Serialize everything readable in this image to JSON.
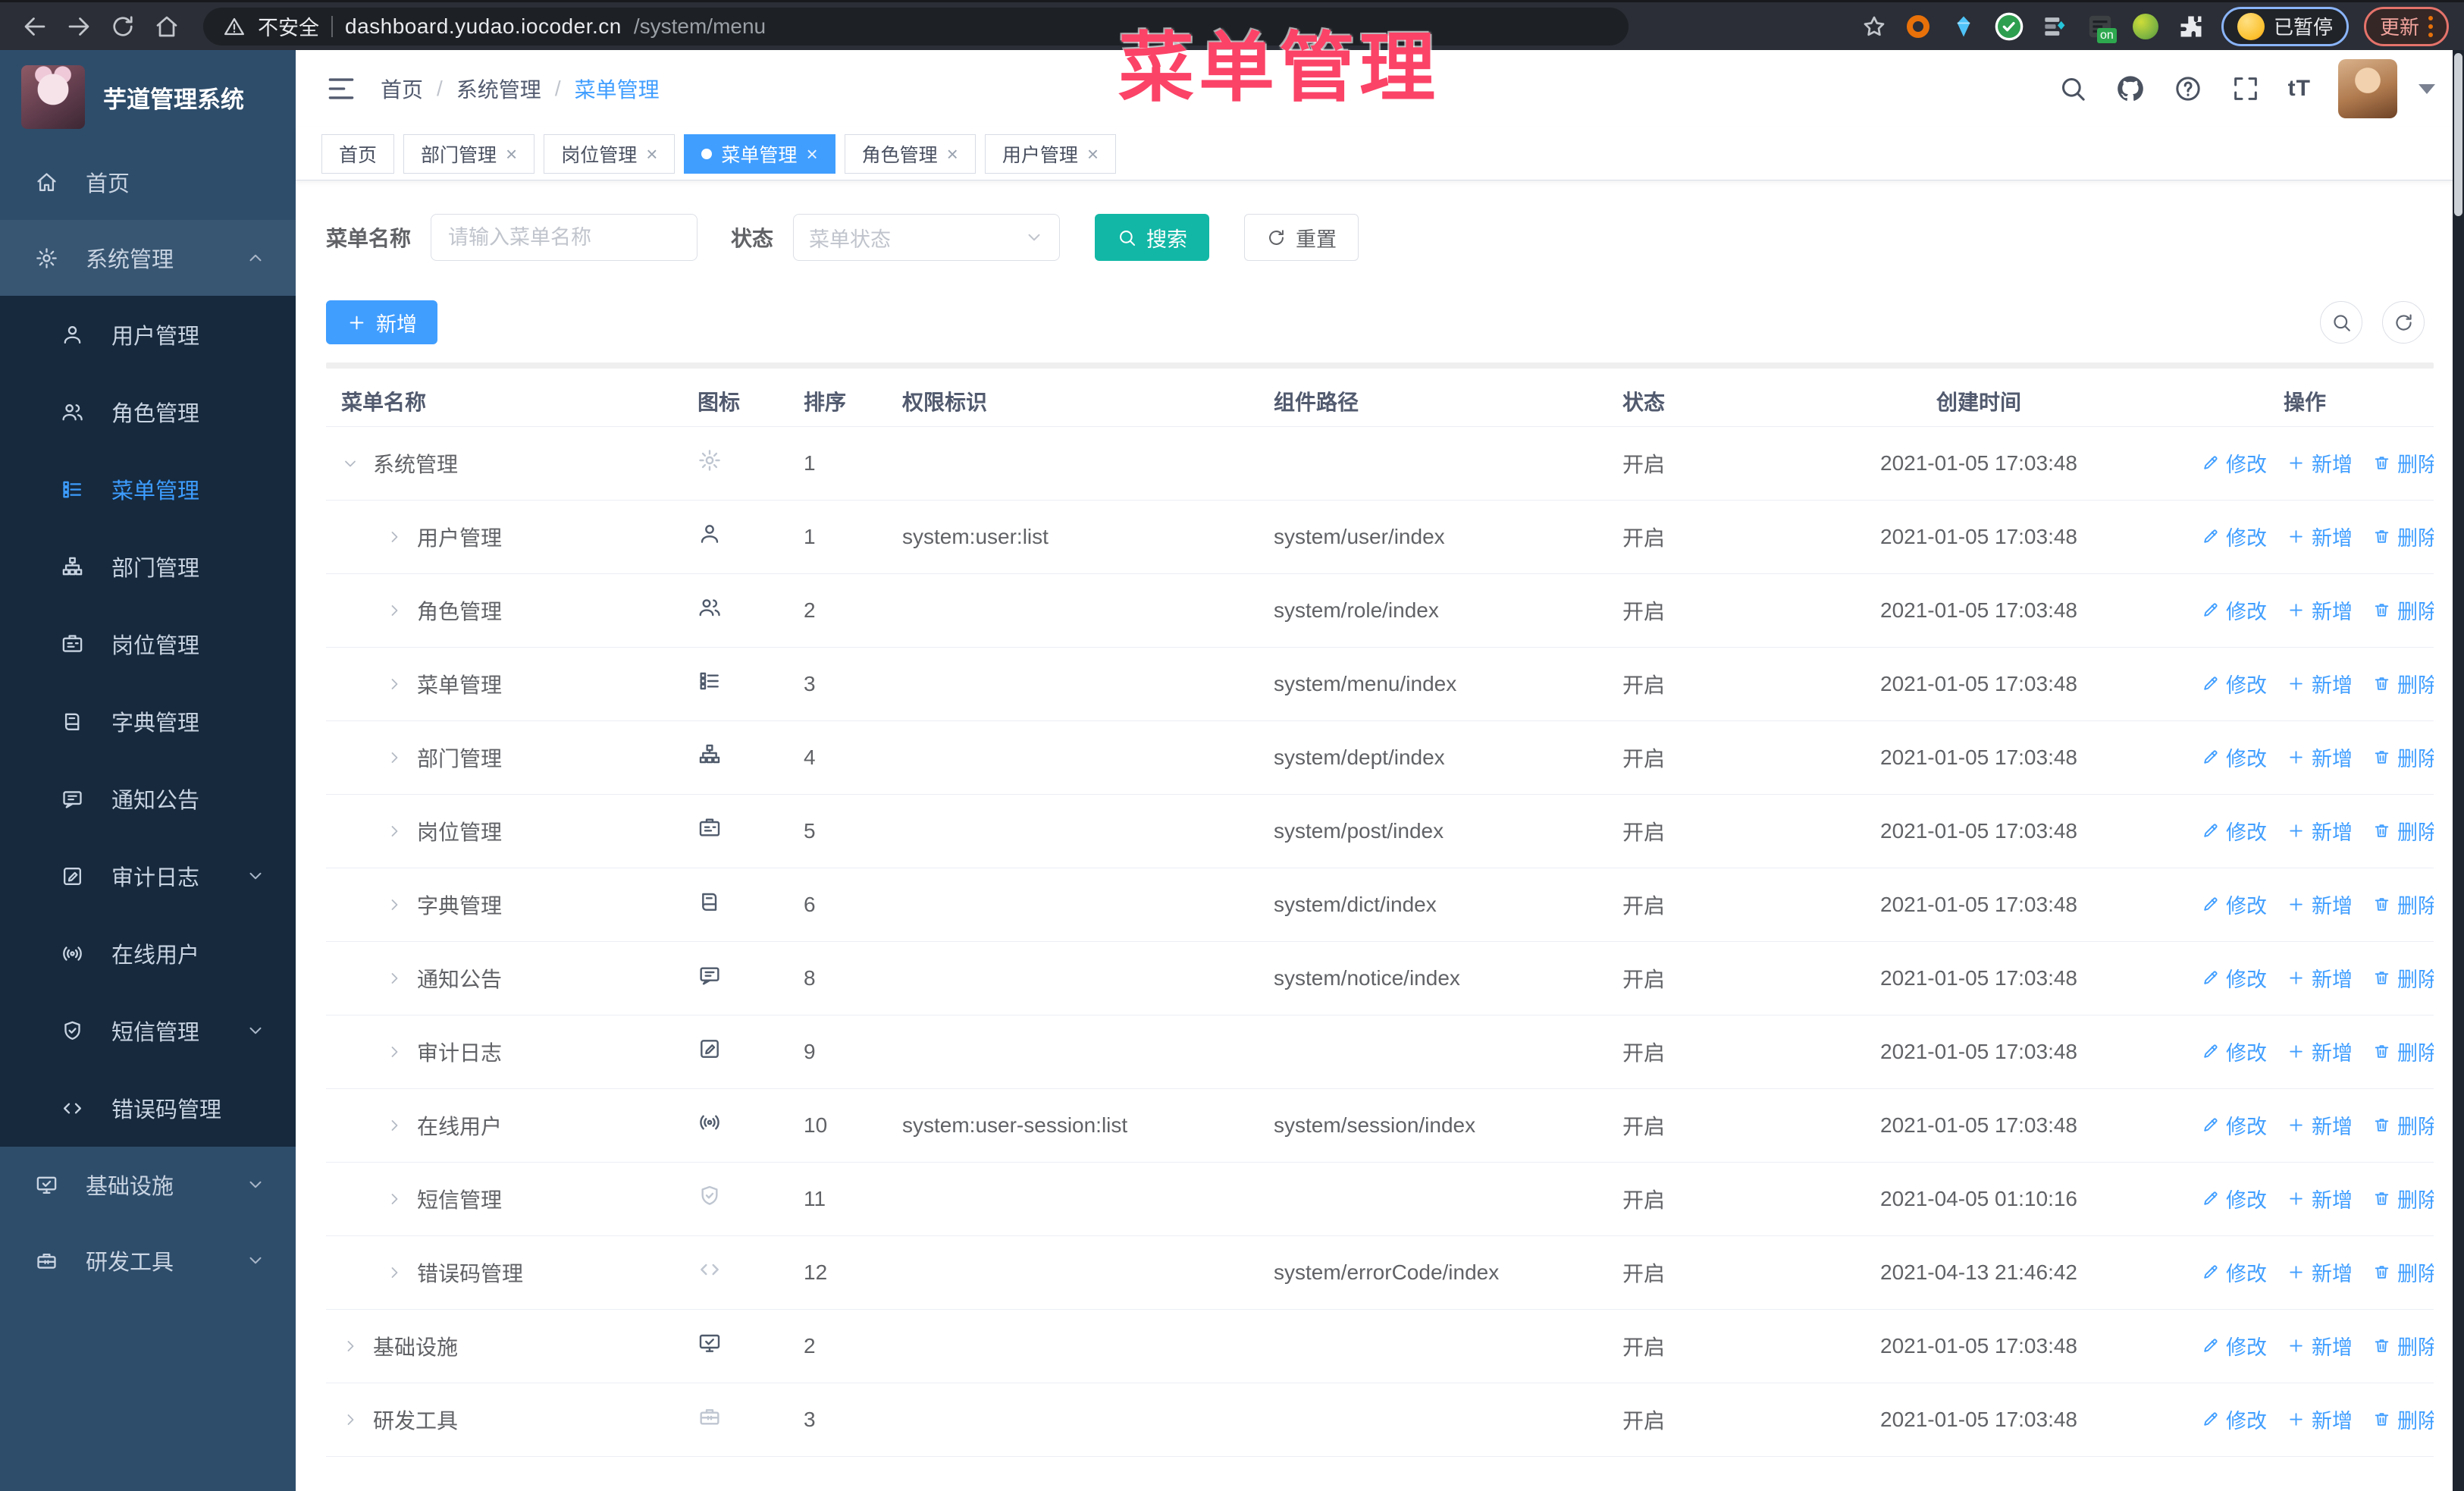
{
  "browser": {
    "insecure_label": "不安全",
    "url_host": "dashboard.yudao.iocoder.cn",
    "url_path": "/system/menu",
    "ext_on_label": "on",
    "paused_label": "已暂停",
    "update_label": "更新"
  },
  "annotation": {
    "title": "菜单管理",
    "color": "#fb4367"
  },
  "sidebar": {
    "app_title": "芋道管理系统",
    "items": [
      {
        "label": "首页",
        "icon": "home-icon",
        "level": 0
      },
      {
        "label": "系统管理",
        "icon": "gear-icon",
        "level": 0,
        "chevron": "up",
        "open": true
      },
      {
        "label": "用户管理",
        "icon": "user-icon",
        "level": 1
      },
      {
        "label": "角色管理",
        "icon": "users-icon",
        "level": 1
      },
      {
        "label": "菜单管理",
        "icon": "menu-icon",
        "level": 1,
        "active": true
      },
      {
        "label": "部门管理",
        "icon": "org-tree-icon",
        "level": 1
      },
      {
        "label": "岗位管理",
        "icon": "badge-icon",
        "level": 1
      },
      {
        "label": "字典管理",
        "icon": "dict-icon",
        "level": 1
      },
      {
        "label": "通知公告",
        "icon": "message-icon",
        "level": 1
      },
      {
        "label": "审计日志",
        "icon": "log-icon",
        "level": 1,
        "chevron": "down"
      },
      {
        "label": "在线用户",
        "icon": "online-icon",
        "level": 1
      },
      {
        "label": "短信管理",
        "icon": "shield-icon",
        "level": 1,
        "chevron": "down"
      },
      {
        "label": "错误码管理",
        "icon": "code-icon",
        "level": 1
      },
      {
        "label": "基础设施",
        "icon": "monitor-icon",
        "level": 0,
        "chevron": "down"
      },
      {
        "label": "研发工具",
        "icon": "toolbox-icon",
        "level": 0,
        "chevron": "down"
      }
    ]
  },
  "breadcrumb": {
    "items": [
      "首页",
      "系统管理",
      "菜单管理"
    ],
    "separator": "/"
  },
  "header": {
    "font_size_glyph": "tT",
    "tool_icons": [
      "search-icon",
      "github-icon",
      "question-icon",
      "fullscreen-icon",
      "font-size-icon"
    ]
  },
  "tabs": [
    {
      "label": "首页",
      "closable": false,
      "active": false
    },
    {
      "label": "部门管理",
      "closable": true,
      "active": false
    },
    {
      "label": "岗位管理",
      "closable": true,
      "active": false
    },
    {
      "label": "菜单管理",
      "closable": true,
      "active": true
    },
    {
      "label": "角色管理",
      "closable": true,
      "active": false
    },
    {
      "label": "用户管理",
      "closable": true,
      "active": false
    }
  ],
  "search": {
    "name_label": "菜单名称",
    "name_placeholder": "请输入菜单名称",
    "name_value": "",
    "status_label": "状态",
    "status_placeholder": "菜单状态",
    "search_button": "搜索",
    "reset_button": "重置"
  },
  "toolbar": {
    "add_button": "新增"
  },
  "table": {
    "columns": [
      "菜单名称",
      "图标",
      "排序",
      "权限标识",
      "组件路径",
      "状态",
      "创建时间",
      "操作"
    ],
    "row_actions": [
      "修改",
      "新增",
      "删除"
    ],
    "rows": [
      {
        "name": "系统管理",
        "icon": "gear-icon",
        "muted_icon": true,
        "level": 0,
        "expanded": true,
        "sort": 1,
        "permission": "",
        "component": "",
        "status": "开启",
        "created": "2021-01-05 17:03:48"
      },
      {
        "name": "用户管理",
        "icon": "user-icon",
        "muted_icon": false,
        "level": 1,
        "expanded": false,
        "sort": 1,
        "permission": "system:user:list",
        "component": "system/user/index",
        "status": "开启",
        "created": "2021-01-05 17:03:48"
      },
      {
        "name": "角色管理",
        "icon": "users-icon",
        "muted_icon": false,
        "level": 1,
        "expanded": false,
        "sort": 2,
        "permission": "",
        "component": "system/role/index",
        "status": "开启",
        "created": "2021-01-05 17:03:48"
      },
      {
        "name": "菜单管理",
        "icon": "menu-icon",
        "muted_icon": false,
        "level": 1,
        "expanded": false,
        "sort": 3,
        "permission": "",
        "component": "system/menu/index",
        "status": "开启",
        "created": "2021-01-05 17:03:48"
      },
      {
        "name": "部门管理",
        "icon": "org-tree-icon",
        "muted_icon": false,
        "level": 1,
        "expanded": false,
        "sort": 4,
        "permission": "",
        "component": "system/dept/index",
        "status": "开启",
        "created": "2021-01-05 17:03:48"
      },
      {
        "name": "岗位管理",
        "icon": "badge-icon",
        "muted_icon": false,
        "level": 1,
        "expanded": false,
        "sort": 5,
        "permission": "",
        "component": "system/post/index",
        "status": "开启",
        "created": "2021-01-05 17:03:48"
      },
      {
        "name": "字典管理",
        "icon": "dict-icon",
        "muted_icon": false,
        "level": 1,
        "expanded": false,
        "sort": 6,
        "permission": "",
        "component": "system/dict/index",
        "status": "开启",
        "created": "2021-01-05 17:03:48"
      },
      {
        "name": "通知公告",
        "icon": "message-icon",
        "muted_icon": false,
        "level": 1,
        "expanded": false,
        "sort": 8,
        "permission": "",
        "component": "system/notice/index",
        "status": "开启",
        "created": "2021-01-05 17:03:48"
      },
      {
        "name": "审计日志",
        "icon": "log-icon",
        "muted_icon": false,
        "level": 1,
        "expanded": false,
        "sort": 9,
        "permission": "",
        "component": "",
        "status": "开启",
        "created": "2021-01-05 17:03:48"
      },
      {
        "name": "在线用户",
        "icon": "online-icon",
        "muted_icon": false,
        "level": 1,
        "expanded": false,
        "sort": 10,
        "permission": "system:user-session:list",
        "component": "system/session/index",
        "status": "开启",
        "created": "2021-01-05 17:03:48"
      },
      {
        "name": "短信管理",
        "icon": "shield-icon",
        "muted_icon": true,
        "level": 1,
        "expanded": false,
        "sort": 11,
        "permission": "",
        "component": "",
        "status": "开启",
        "created": "2021-04-05 01:10:16"
      },
      {
        "name": "错误码管理",
        "icon": "code-icon",
        "muted_icon": true,
        "level": 1,
        "expanded": false,
        "sort": 12,
        "permission": "",
        "component": "system/errorCode/index",
        "status": "开启",
        "created": "2021-04-13 21:46:42"
      },
      {
        "name": "基础设施",
        "icon": "monitor-icon",
        "muted_icon": false,
        "level": 0,
        "expanded": false,
        "sort": 2,
        "permission": "",
        "component": "",
        "status": "开启",
        "created": "2021-01-05 17:03:48"
      },
      {
        "name": "研发工具",
        "icon": "toolbox-icon",
        "muted_icon": true,
        "level": 0,
        "expanded": false,
        "sort": 3,
        "permission": "",
        "component": "",
        "status": "开启",
        "created": "2021-01-05 17:03:48"
      }
    ]
  }
}
